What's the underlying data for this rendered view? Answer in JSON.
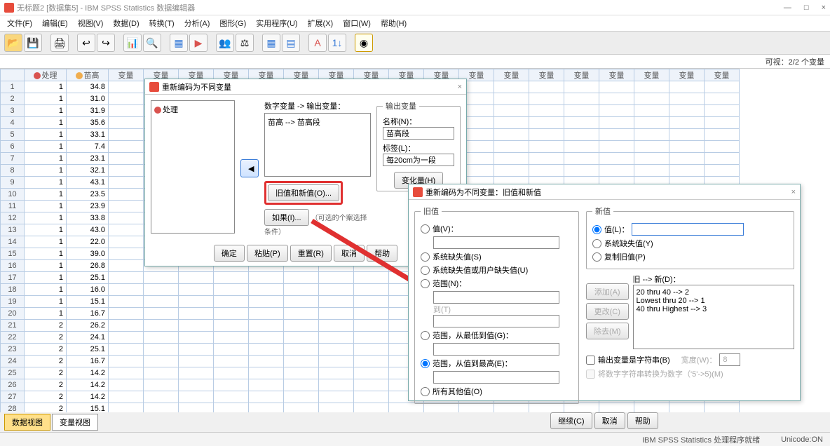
{
  "window": {
    "title": "无标题2 [数据集5] - IBM SPSS Statistics 数据编辑器"
  },
  "win_controls": {
    "min": "—",
    "max": "□",
    "close": "×"
  },
  "menu": [
    "文件(F)",
    "编辑(E)",
    "视图(V)",
    "数据(D)",
    "转换(T)",
    "分析(A)",
    "图形(G)",
    "实用程序(U)",
    "扩展(X)",
    "窗口(W)",
    "帮助(H)"
  ],
  "infobar": "可视：2/2 个变量",
  "columns": {
    "c1": "处理",
    "c2": "苗高",
    "empty": "变量"
  },
  "rows": [
    {
      "n": 1,
      "a": 1,
      "b": "34.8"
    },
    {
      "n": 2,
      "a": 1,
      "b": "31.0"
    },
    {
      "n": 3,
      "a": 1,
      "b": "31.9"
    },
    {
      "n": 4,
      "a": 1,
      "b": "35.6"
    },
    {
      "n": 5,
      "a": 1,
      "b": "33.1"
    },
    {
      "n": 6,
      "a": 1,
      "b": "7.4"
    },
    {
      "n": 7,
      "a": 1,
      "b": "23.1"
    },
    {
      "n": 8,
      "a": 1,
      "b": "32.1"
    },
    {
      "n": 9,
      "a": 1,
      "b": "43.1"
    },
    {
      "n": 10,
      "a": 1,
      "b": "23.5"
    },
    {
      "n": 11,
      "a": 1,
      "b": "23.9"
    },
    {
      "n": 12,
      "a": 1,
      "b": "33.8"
    },
    {
      "n": 13,
      "a": 1,
      "b": "43.0"
    },
    {
      "n": 14,
      "a": 1,
      "b": "22.0"
    },
    {
      "n": 15,
      "a": 1,
      "b": "39.0"
    },
    {
      "n": 16,
      "a": 1,
      "b": "26.8"
    },
    {
      "n": 17,
      "a": 1,
      "b": "25.1"
    },
    {
      "n": 18,
      "a": 1,
      "b": "16.0"
    },
    {
      "n": 19,
      "a": 1,
      "b": "15.1"
    },
    {
      "n": 20,
      "a": 1,
      "b": "16.7"
    },
    {
      "n": 21,
      "a": 2,
      "b": "26.2"
    },
    {
      "n": 22,
      "a": 2,
      "b": "24.1"
    },
    {
      "n": 23,
      "a": 2,
      "b": "25.1"
    },
    {
      "n": 24,
      "a": 2,
      "b": "16.7"
    },
    {
      "n": 25,
      "a": 2,
      "b": "14.2"
    },
    {
      "n": 26,
      "a": 2,
      "b": "14.2"
    },
    {
      "n": 27,
      "a": 2,
      "b": "14.2"
    },
    {
      "n": 28,
      "a": 2,
      "b": "15.1"
    }
  ],
  "tabs": {
    "data": "数据视图",
    "var": "变量视图"
  },
  "status": {
    "msg": "IBM SPSS Statistics 处理程序就绪",
    "unicode": "Unicode:ON"
  },
  "dlg1": {
    "title": "重新编码为不同变量",
    "left_item": "处理",
    "mid_label": "数字变量 -> 输出变量：",
    "mid_item": "苗高 --> 苗高段",
    "out_heading": "输出变量",
    "name_label": "名称(N)：",
    "name_val": "苗高段",
    "lab_label": "标签(L)：",
    "lab_val": "每20cm为一段",
    "change": "变化量(H)",
    "oldnew": "旧值和新值(O)...",
    "if": "如果(I)...",
    "if_note": "（可选的个案选择条件）",
    "ok": "确定",
    "paste": "粘贴(P)",
    "reset": "重置(R)",
    "cancel": "取消",
    "help": "帮助"
  },
  "dlg2": {
    "title": "重新编码为不同变量：旧值和新值",
    "old": "旧值",
    "new": "新值",
    "r1": "值(V)：",
    "r2": "系统缺失值(S)",
    "r3": "系统缺失值或用户缺失值(U)",
    "r4": "范围(N)：",
    "r4to": "到(T)",
    "r5": "范围，从最低到值(G)：",
    "r6": "范围，从值到最高(E)：",
    "r7": "所有其他值(O)",
    "n1": "值(L)：",
    "n2": "系统缺失值(Y)",
    "n3": "复制旧值(P)",
    "map_label": "旧 --> 新(D)：",
    "map": [
      "20 thru 40 --> 2",
      "Lowest thru 20 --> 1",
      "40 thru Highest --> 3"
    ],
    "add": "添加(A)",
    "chg": "更改(C)",
    "rem": "除去(M)",
    "chk1": "输出变量是字符串(B)",
    "width": "宽度(W)：",
    "width_val": "8",
    "chk2": "将数字字符串转换为数字（'5'->5)(M)",
    "cont": "继续(C)",
    "cancel": "取消",
    "help": "帮助"
  }
}
